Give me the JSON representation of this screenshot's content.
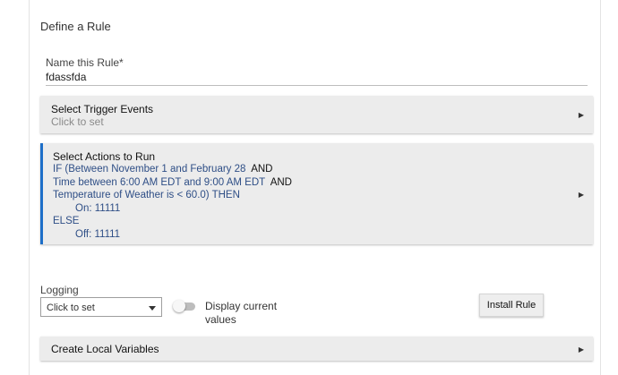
{
  "section": {
    "title": "Define a Rule"
  },
  "name_field": {
    "label": "Name this Rule*",
    "value": "fdassfda"
  },
  "trigger_panel": {
    "title": "Select Trigger Events",
    "subtitle": "Click to set"
  },
  "actions_panel": {
    "title": "Select Actions to Run",
    "lines": [
      {
        "text": "IF (Between November 1 and February 28",
        "keyword": "AND"
      },
      {
        "text": "Time between 6:00 AM EDT and 9:00 AM EDT",
        "keyword": "AND"
      },
      {
        "text": "Temperature of Weather is < 60.0) THEN",
        "keyword": ""
      },
      {
        "text": "On: 11111",
        "keyword": ""
      },
      {
        "text": "ELSE",
        "keyword": ""
      },
      {
        "text": "Off: 11111",
        "keyword": ""
      }
    ]
  },
  "logging": {
    "label": "Logging",
    "selected": "Click to set"
  },
  "display_toggle": {
    "label": "Display current values",
    "on": false
  },
  "install_button": {
    "label": "Install Rule"
  },
  "locals_panel": {
    "title": "Create Local Variables"
  },
  "icons": {
    "expand": "triangle-right-icon",
    "dropdown": "caret-down-icon"
  },
  "colors": {
    "accent": "#1e6fc8",
    "action_text": "#2e4e86",
    "panel_bg": "#ececec"
  }
}
